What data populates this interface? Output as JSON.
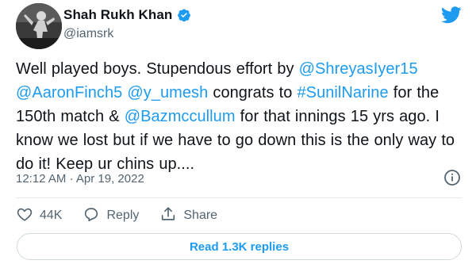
{
  "author": {
    "display_name": "Shah Rukh Khan",
    "handle": "@iamsrk",
    "verified": true
  },
  "tweet": {
    "segments": [
      {
        "text": "Well played boys. Stupendous effort by ",
        "type": "text"
      },
      {
        "text": "@ShreyasIyer15",
        "type": "mention"
      },
      {
        "text": " ",
        "type": "text"
      },
      {
        "text": "@AaronFinch5",
        "type": "mention"
      },
      {
        "text": " ",
        "type": "text"
      },
      {
        "text": "@y_umesh",
        "type": "mention"
      },
      {
        "text": " congrats to ",
        "type": "text"
      },
      {
        "text": "#SunilNarine",
        "type": "hashtag"
      },
      {
        "text": " for the 150th match & ",
        "type": "text"
      },
      {
        "text": "@Bazmccullum",
        "type": "mention"
      },
      {
        "text": " for that innings 15 yrs ago. I know we lost but if we have to go down this is the only way to do it! Keep ur chins up....",
        "type": "text"
      }
    ],
    "time": "12:12 AM",
    "separator": "·",
    "date": "Apr 19, 2022"
  },
  "actions": {
    "like_count": "44K",
    "reply_label": "Reply",
    "share_label": "Share"
  },
  "read_replies_label": "Read 1.3K replies",
  "icons": {
    "verified": "verified-badge-icon",
    "brand": "twitter-bird-icon",
    "info": "info-icon",
    "like": "heart-icon",
    "reply": "reply-bubble-icon",
    "share": "share-icon"
  },
  "colors": {
    "link": "#1d9bf0",
    "muted": "#536471",
    "text": "#0f1419",
    "border": "#cfd9de"
  }
}
